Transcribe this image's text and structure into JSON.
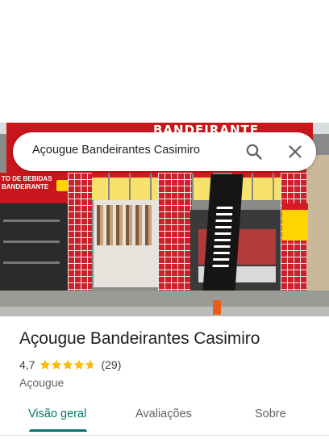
{
  "search": {
    "query": "Açougue Bandeirantes Casimiro",
    "search_icon": "search-icon",
    "close_icon": "close-icon"
  },
  "photo": {
    "awning_text": "BANDEIRANTE",
    "side_sign_line1": "TO DE BEBIDAS",
    "side_sign_line2": "BANDEIRANTE"
  },
  "place": {
    "name": "Açougue Bandeirantes Casimiro",
    "rating": "4,7",
    "stars": 4.7,
    "review_count": "(29)",
    "category": "Açougue"
  },
  "tabs": [
    {
      "label": "Visão geral",
      "active": true
    },
    {
      "label": "Avaliações",
      "active": false
    },
    {
      "label": "Sobre",
      "active": false
    }
  ],
  "colors": {
    "accent": "#00796b",
    "star": "#fbbc04",
    "star_empty": "#dadce0",
    "storefront_red": "#c8161c"
  }
}
